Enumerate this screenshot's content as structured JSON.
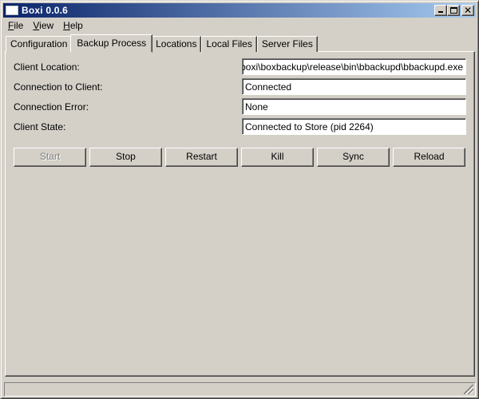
{
  "window": {
    "title": "Boxi 0.0.6"
  },
  "menu": {
    "file": {
      "mnemonic": "F",
      "rest": "ile"
    },
    "view": {
      "mnemonic": "V",
      "rest": "iew"
    },
    "help": {
      "mnemonic": "H",
      "rest": "elp"
    }
  },
  "tabs": [
    {
      "label": "Configuration",
      "active": false
    },
    {
      "label": "Backup Process",
      "active": true
    },
    {
      "label": "Locations",
      "active": false
    },
    {
      "label": "Local Files",
      "active": false
    },
    {
      "label": "Server Files",
      "active": false
    }
  ],
  "fields": {
    "client_location": {
      "label": "Client Location:",
      "value": "on\\boxi\\boxbackup\\release\\bin\\bbackupd\\bbackupd.exe"
    },
    "connection_to_client": {
      "label": "Connection to Client:",
      "value": "Connected"
    },
    "connection_error": {
      "label": "Connection Error:",
      "value": "None"
    },
    "client_state": {
      "label": "Client State:",
      "value": "Connected to Store (pid 2264)"
    }
  },
  "buttons": {
    "start": {
      "label": "Start",
      "enabled": false
    },
    "stop": {
      "label": "Stop",
      "enabled": true
    },
    "restart": {
      "label": "Restart",
      "enabled": true
    },
    "kill": {
      "label": "Kill",
      "enabled": true
    },
    "sync": {
      "label": "Sync",
      "enabled": true
    },
    "reload": {
      "label": "Reload",
      "enabled": true
    }
  },
  "icons": {
    "app": "app-icon",
    "minimize": "minimize-icon",
    "maximize": "maximize-icon",
    "close": "close-icon",
    "grip": "resize-grip-icon"
  },
  "colors": {
    "face": "#d4d0c8",
    "titlebar_start": "#0a246a",
    "titlebar_end": "#a6caf0"
  }
}
